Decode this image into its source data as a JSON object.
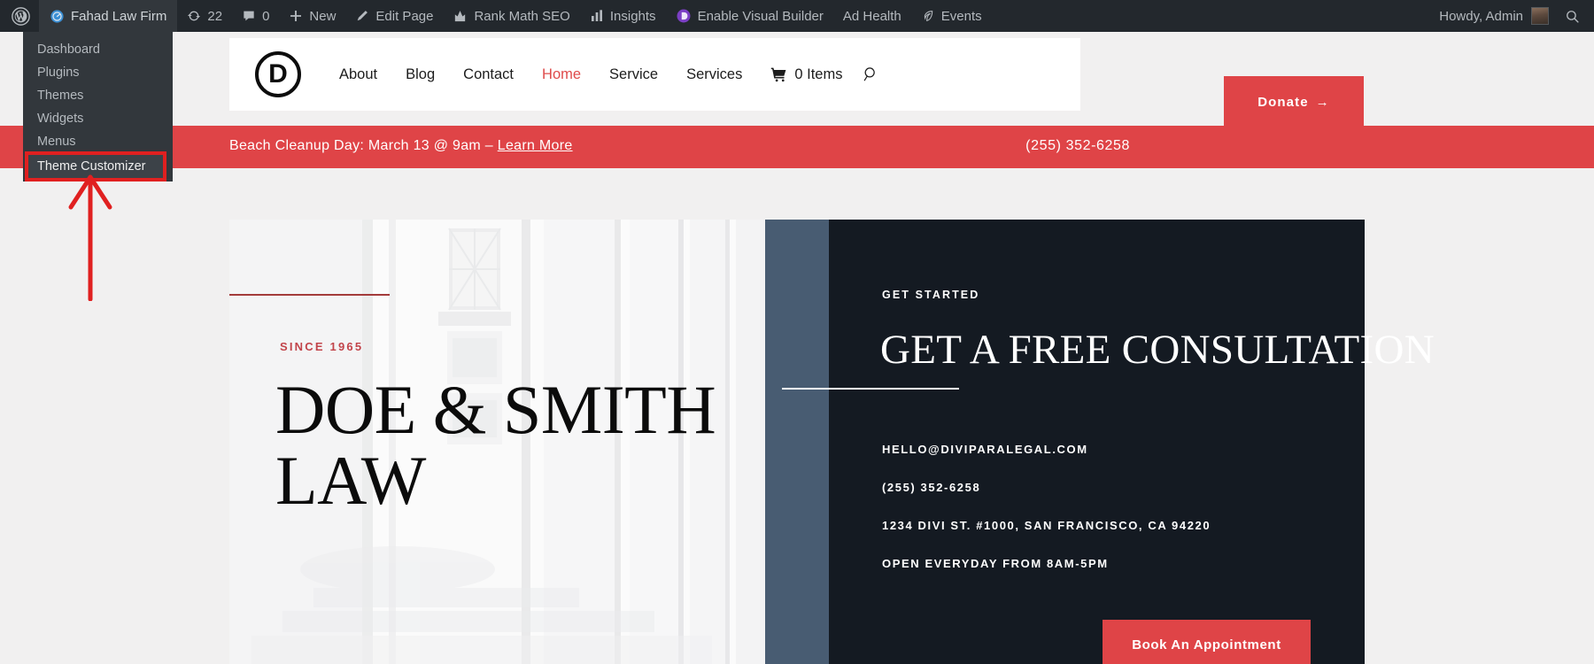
{
  "adminbar": {
    "wp_logo": "wordpress-logo-icon",
    "site_name": "Fahad Law Firm",
    "updates_count": "22",
    "comments_count": "0",
    "new_label": "New",
    "edit_page_label": "Edit Page",
    "rank_math_label": "Rank Math SEO",
    "insights_label": "Insights",
    "visual_builder_label": "Enable Visual Builder",
    "ad_health_label": "Ad Health",
    "events_label": "Events",
    "howdy_label": "Howdy, Admin",
    "bg_color": "#23282d"
  },
  "dropdown": {
    "items": [
      {
        "label": "Dashboard"
      },
      {
        "label": "Plugins"
      },
      {
        "label": "Themes"
      },
      {
        "label": "Widgets"
      },
      {
        "label": "Menus"
      },
      {
        "label": "Theme Customizer"
      }
    ],
    "highlight_index": 5,
    "highlight_color": "#e02020"
  },
  "annotation": {
    "arrow_color": "#e02020",
    "points_to": "Theme Customizer"
  },
  "site": {
    "logo_letter": "D",
    "nav": [
      {
        "label": "About",
        "active": false
      },
      {
        "label": "Blog",
        "active": false
      },
      {
        "label": "Contact",
        "active": false
      },
      {
        "label": "Home",
        "active": true
      },
      {
        "label": "Service",
        "active": false
      },
      {
        "label": "Services",
        "active": false
      }
    ],
    "cart_label": "0 Items",
    "donate_label": "Donate",
    "donate_arrow": "→",
    "accent_color": "#df4447"
  },
  "banner": {
    "text_before": "Beach Cleanup Day: March 13 @ 9am – ",
    "link_label": "Learn More",
    "phone": "(255) 352-6258",
    "bg_color": "#df4447"
  },
  "hero": {
    "since": "SINCE 1965",
    "title": "DOE & SMITH LAW",
    "eyebrow": "GET STARTED",
    "consult_title": "GET A FREE CONSULTATION",
    "contacts": [
      "HELLO@DIVIPARALEGAL.COM",
      "(255) 352-6258",
      "1234 DIVI ST. #1000, SAN FRANCISCO, CA 94220",
      "OPEN EVERYDAY FROM 8AM-5PM"
    ],
    "appointment_label": "Book An Appointment",
    "dark_color": "#141a22",
    "blue_color": "#485c72"
  }
}
